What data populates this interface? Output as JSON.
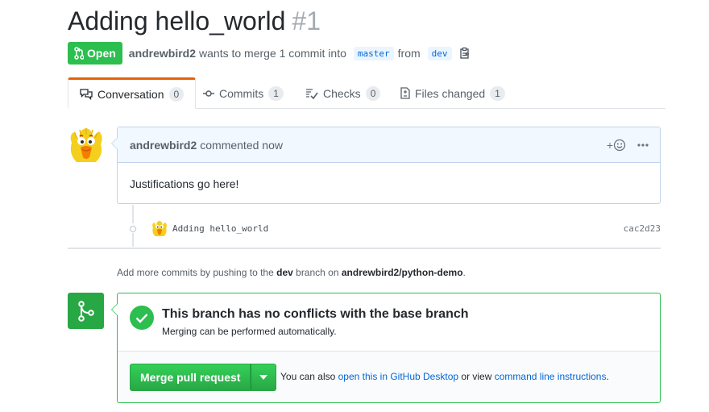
{
  "pr": {
    "title": "Adding hello_world",
    "number": "#1",
    "state": "Open",
    "author": "andrewbird2",
    "summary_prefix": "wants to merge 1 commit into",
    "base_branch": "master",
    "from_text": "from",
    "head_branch": "dev"
  },
  "tabs": [
    {
      "label": "Conversation",
      "count": "0",
      "icon": "comment-discussion-icon"
    },
    {
      "label": "Commits",
      "count": "1",
      "icon": "git-commit-icon"
    },
    {
      "label": "Checks",
      "count": "0",
      "icon": "checklist-icon"
    },
    {
      "label": "Files changed",
      "count": "1",
      "icon": "file-diff-icon"
    }
  ],
  "comment": {
    "author": "andrewbird2",
    "action": "commented now",
    "body": "Justifications go here!",
    "react_plus": "+"
  },
  "commit": {
    "message": "Adding hello_world",
    "sha": "cac2d23"
  },
  "hint": {
    "prefix": "Add more commits by pushing to the",
    "branch": "dev",
    "middle": "branch on",
    "repo": "andrewbird2/python-demo",
    "suffix": "."
  },
  "merge": {
    "heading": "This branch has no conflicts with the base branch",
    "subtext": "Merging can be performed automatically.",
    "button_label": "Merge pull request",
    "alt_prefix": "You can also",
    "desktop_link": "open this in GitHub Desktop",
    "alt_middle": "or view",
    "cli_link": "command line instructions",
    "alt_suffix": "."
  },
  "colors": {
    "open_green": "#2cbe4e",
    "link_blue": "#0366d6",
    "tab_accent": "#e36209",
    "comment_border": "#c0d3eb"
  }
}
